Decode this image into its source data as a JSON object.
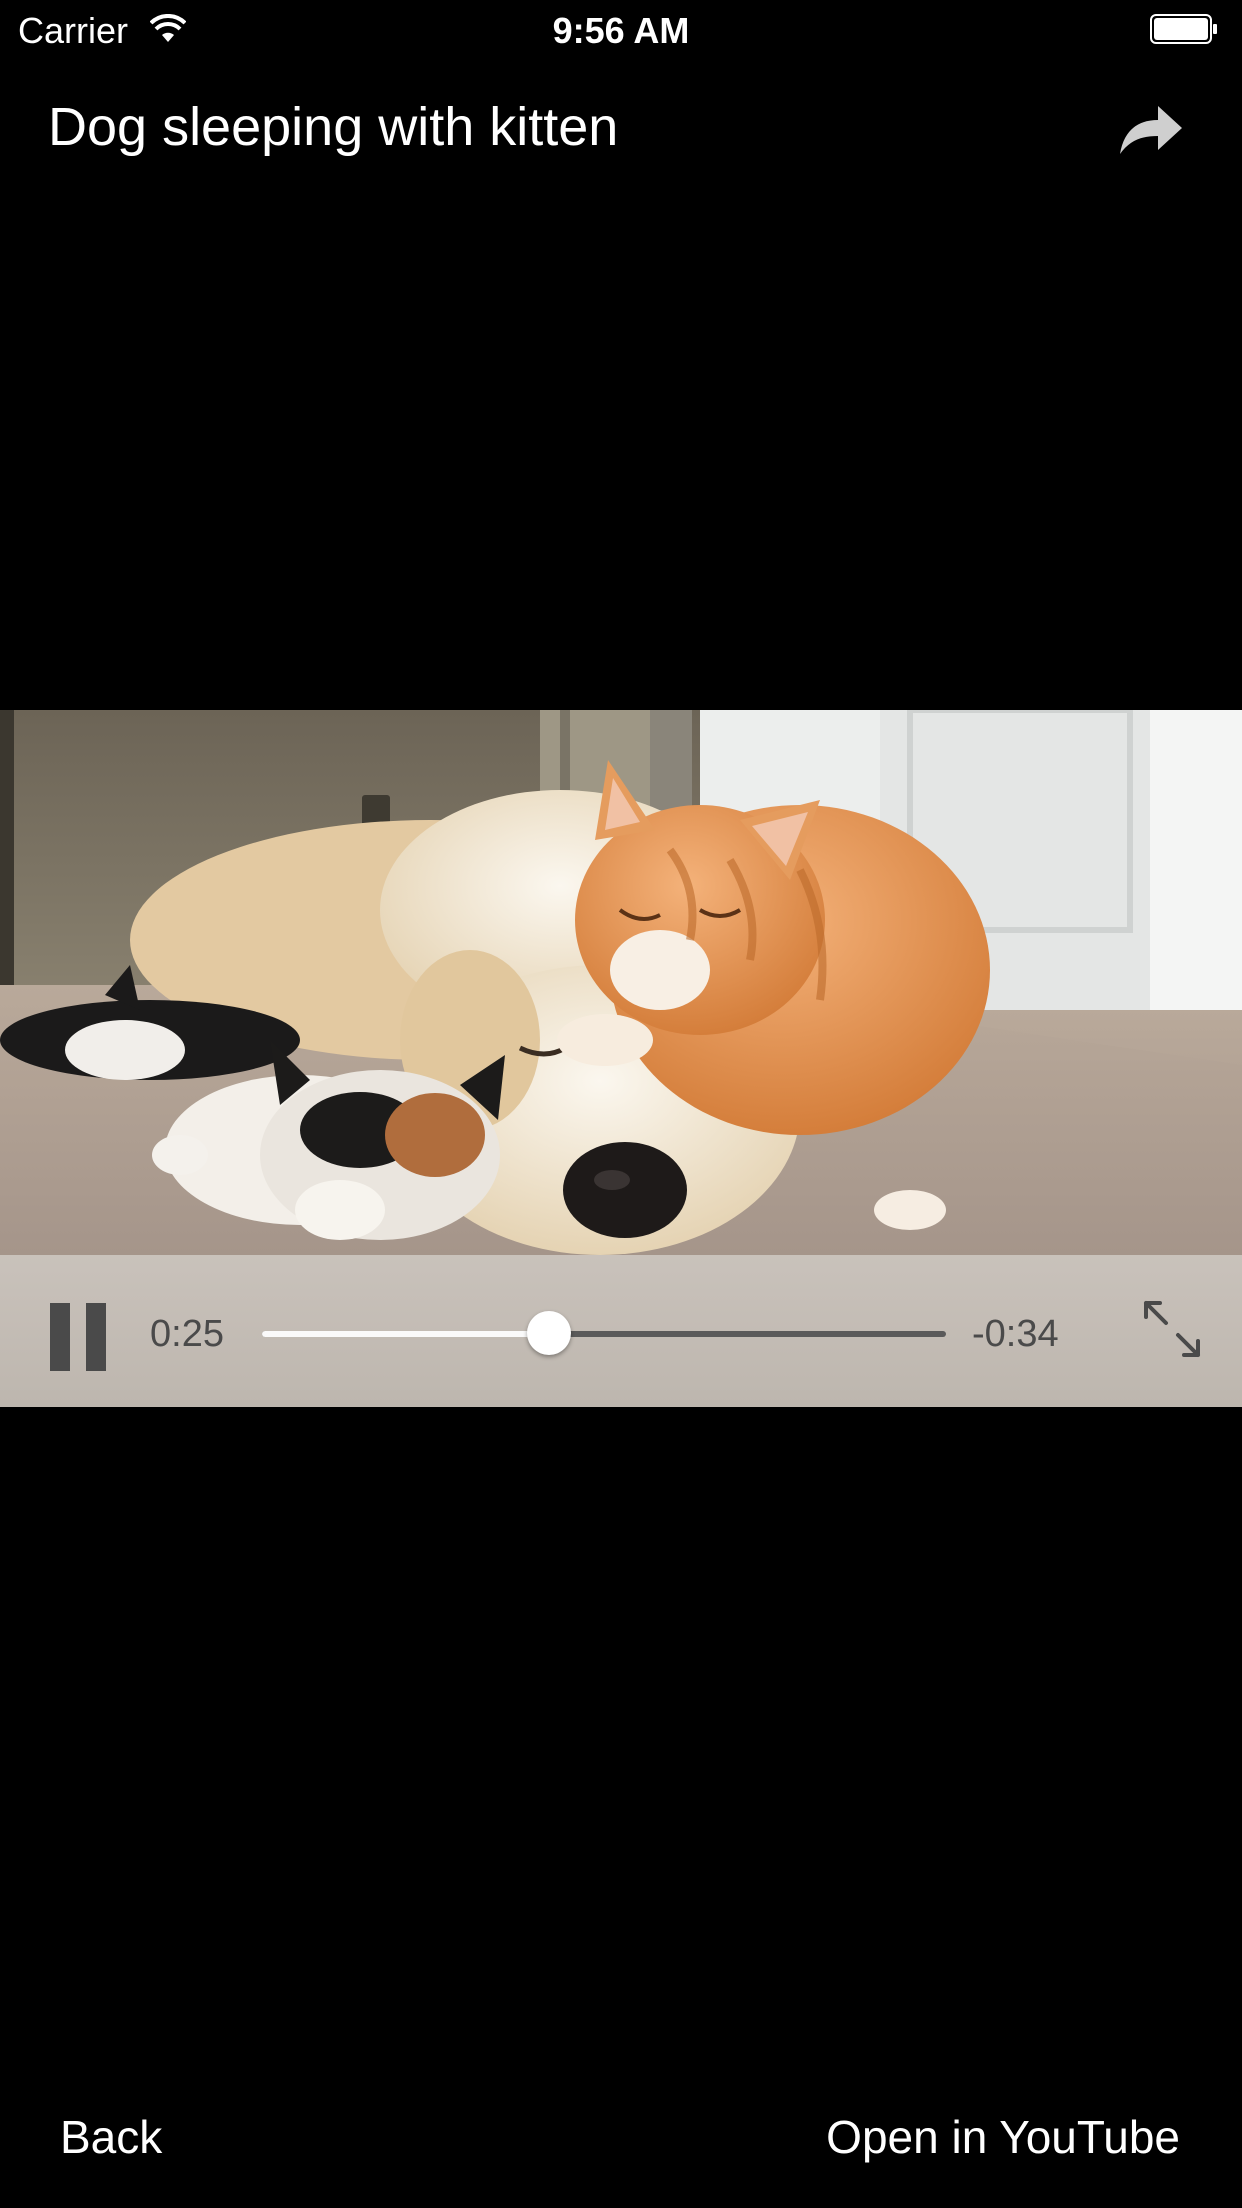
{
  "status_bar": {
    "carrier": "Carrier",
    "time": "9:56 AM"
  },
  "header": {
    "title": "Dog sleeping with kitten",
    "share_icon": "share-arrow-icon"
  },
  "player": {
    "elapsed": "0:25",
    "remaining": "-0:34",
    "progress_fraction": 0.42,
    "pause_icon": "pause-icon",
    "fullscreen_icon": "fullscreen-expand-icon"
  },
  "footer": {
    "back_label": "Back",
    "open_label": "Open in YouTube"
  },
  "colors": {
    "background": "#000000",
    "controls_bg": "#c4bdb5",
    "controls_fg": "#4a4a4a",
    "text": "#ffffff"
  }
}
